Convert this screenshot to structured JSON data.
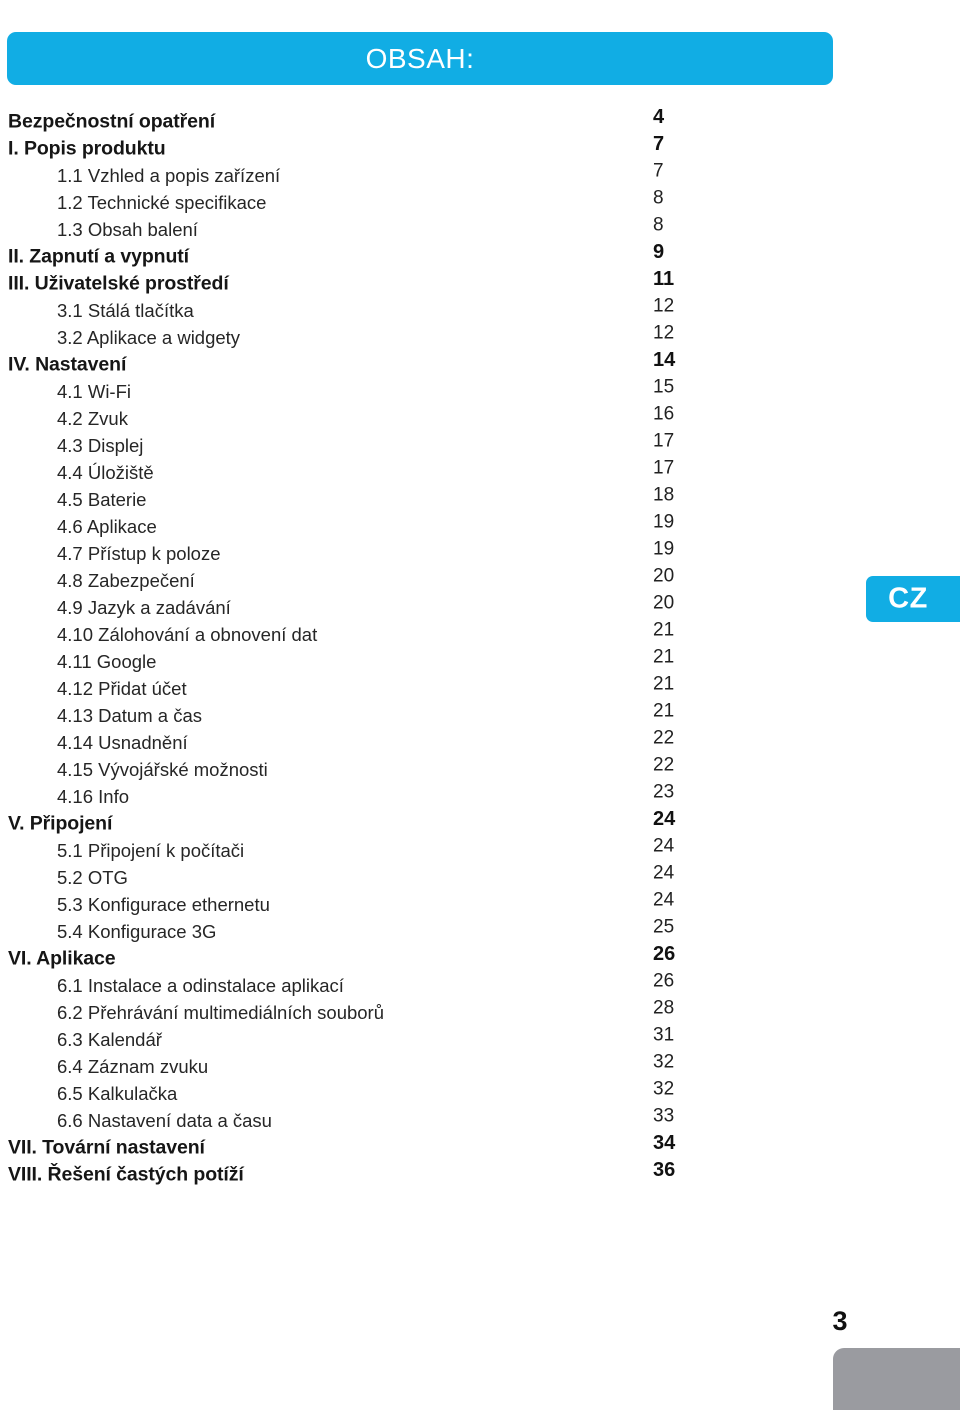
{
  "document": {
    "banner_title": "OBSAH:",
    "language_tab": "CZ",
    "page_number": "3",
    "accent_color": "#11ade4",
    "footer_block_color": "#9a9ba0"
  },
  "toc": {
    "entries": [
      {
        "label": "Bezpečnostní opatření",
        "page": "4",
        "level": "main"
      },
      {
        "label": "I.  Popis produktu",
        "page": "7",
        "level": "main"
      },
      {
        "label": "1.1 Vzhled a popis zařízení",
        "page": "7",
        "level": "sub"
      },
      {
        "label": "1.2 Technické specifikace",
        "page": "8",
        "level": "sub"
      },
      {
        "label": "1.3 Obsah balení",
        "page": "8",
        "level": "sub"
      },
      {
        "label": "II. Zapnutí a vypnutí",
        "page": "9",
        "level": "main"
      },
      {
        "label": "III. Uživatelské prostředí",
        "page": "11",
        "level": "main"
      },
      {
        "label": "3.1 Stálá tlačítka",
        "page": "12",
        "level": "sub"
      },
      {
        "label": "3.2 Aplikace a widgety",
        "page": "12",
        "level": "sub"
      },
      {
        "label": "IV. Nastavení",
        "page": "14",
        "level": "main"
      },
      {
        "label": "4.1 Wi-Fi",
        "page": "15",
        "level": "sub"
      },
      {
        "label": "4.2 Zvuk",
        "page": "16",
        "level": "sub"
      },
      {
        "label": "4.3 Displej",
        "page": "17",
        "level": "sub"
      },
      {
        "label": "4.4 Úložiště",
        "page": "17",
        "level": "sub"
      },
      {
        "label": "4.5 Baterie",
        "page": "18",
        "level": "sub"
      },
      {
        "label": "4.6 Aplikace",
        "page": "19",
        "level": "sub"
      },
      {
        "label": "4.7 Přístup k poloze",
        "page": "19",
        "level": "sub"
      },
      {
        "label": "4.8 Zabezpečení",
        "page": "20",
        "level": "sub"
      },
      {
        "label": "4.9 Jazyk a zadávání",
        "page": "20",
        "level": "sub"
      },
      {
        "label": "4.10 Zálohování a obnovení dat",
        "page": "21",
        "level": "sub"
      },
      {
        "label": "4.11 Google",
        "page": "21",
        "level": "sub"
      },
      {
        "label": "4.12 Přidat účet",
        "page": "21",
        "level": "sub"
      },
      {
        "label": "4.13 Datum a čas",
        "page": "21",
        "level": "sub"
      },
      {
        "label": "4.14 Usnadnění",
        "page": "22",
        "level": "sub"
      },
      {
        "label": "4.15 Vývojářské možnosti",
        "page": "22",
        "level": "sub"
      },
      {
        "label": "4.16 Info",
        "page": "23",
        "level": "sub"
      },
      {
        "label": "V. Připojení",
        "page": "24",
        "level": "main"
      },
      {
        "label": "5.1 Připojení k počítači",
        "page": "24",
        "level": "sub"
      },
      {
        "label": "5.2 OTG",
        "page": "24",
        "level": "sub"
      },
      {
        "label": "5.3 Konfigurace ethernetu",
        "page": "24",
        "level": "sub"
      },
      {
        "label": "5.4 Konfigurace 3G",
        "page": "25",
        "level": "sub"
      },
      {
        "label": "VI. Aplikace",
        "page": "26",
        "level": "main"
      },
      {
        "label": "6.1 Instalace a odinstalace aplikací",
        "page": "26",
        "level": "sub"
      },
      {
        "label": "6.2 Přehrávání multimediálních souborů",
        "page": "28",
        "level": "sub"
      },
      {
        "label": "6.3 Kalendář",
        "page": "31",
        "level": "sub"
      },
      {
        "label": "6.4 Záznam zvuku",
        "page": "32",
        "level": "sub"
      },
      {
        "label": "6.5 Kalkulačka",
        "page": "32",
        "level": "sub"
      },
      {
        "label": "6.6 Nastavení data a času",
        "page": "33",
        "level": "sub"
      },
      {
        "label": "VII. Tovární nastavení",
        "page": "34",
        "level": "main"
      },
      {
        "label": "VIII. Řešení častých potíží",
        "page": "36",
        "level": "main"
      }
    ]
  }
}
